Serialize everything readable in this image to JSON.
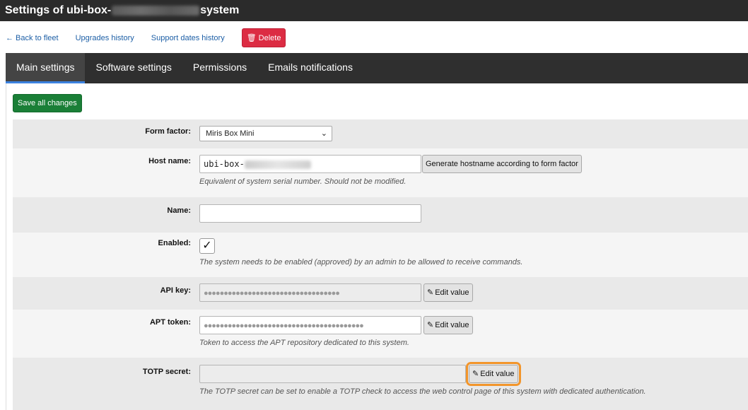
{
  "title": {
    "prefix": "Settings of ubi-box-",
    "suffix": "system"
  },
  "actions": {
    "back": "← Back to fleet",
    "upgrades": "Upgrades history",
    "support": "Support dates history",
    "delete": "Delete"
  },
  "tabs": [
    "Main settings",
    "Software settings",
    "Permissions",
    "Emails notifications"
  ],
  "save_label": "Save all changes",
  "fields": {
    "form_factor": {
      "label": "Form factor:",
      "value": "Miris Box Mini"
    },
    "host_name": {
      "label": "Host name:",
      "value": "ubi-box-",
      "button": "Generate hostname according to form factor",
      "help": "Equivalent of system serial number. Should not be modified."
    },
    "name": {
      "label": "Name:",
      "value": ""
    },
    "enabled": {
      "label": "Enabled:",
      "checked": true,
      "help": "The system needs to be enabled (approved) by an admin to be allowed to receive commands."
    },
    "api_key": {
      "label": "API key:",
      "value": "●●●●●●●●●●●●●●●●●●●●●●●●●●●●●●●●●●",
      "button": "Edit value"
    },
    "apt_token": {
      "label": "APT token:",
      "value": "●●●●●●●●●●●●●●●●●●●●●●●●●●●●●●●●●●●●●●●●",
      "button": "Edit value",
      "help": "Token to access the APT repository dedicated to this system."
    },
    "totp_secret": {
      "label": "TOTP secret:",
      "value": "",
      "button": "Edit value",
      "help": "The TOTP secret can be set to enable a TOTP check to access the web control page of this system with dedicated authentication."
    }
  },
  "colors": {
    "accent": "#3b82e0",
    "save": "#1a7f37",
    "delete": "#dc2c43",
    "highlight": "#f2952b"
  }
}
